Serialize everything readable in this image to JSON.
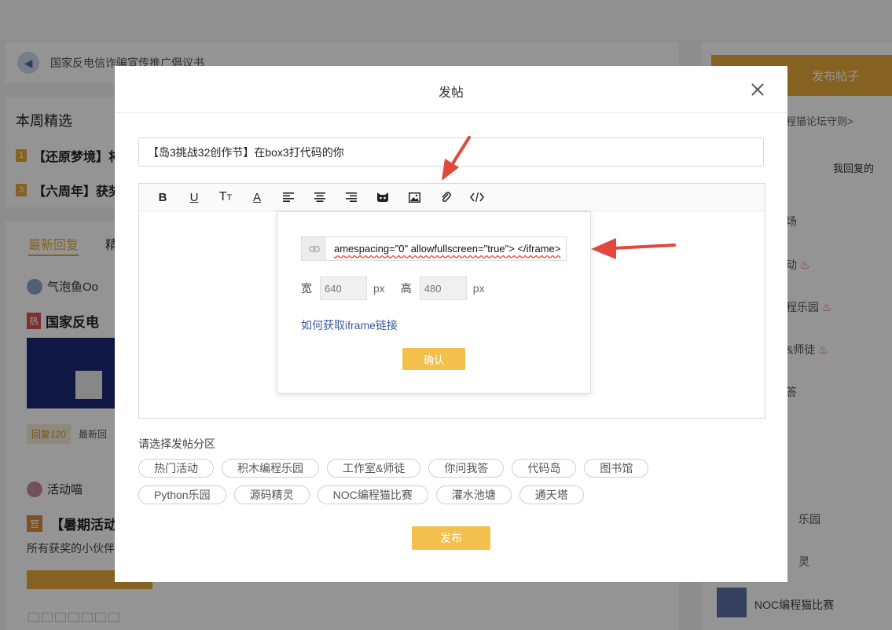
{
  "background": {
    "notice_text": "国家反电信诈骗宣传推广倡议书",
    "weekly_title": "本周精选",
    "weekly_items": [
      {
        "rank": "1",
        "text": "【还原梦境】将"
      },
      {
        "rank": "3",
        "text": "【六周年】获奖"
      }
    ],
    "tabs": [
      "最新回复",
      "精"
    ],
    "post1_user": "气泡鱼Oo",
    "post1_hot_tag": "热",
    "post1_title": "国家反电",
    "post1_reply_tag": "回复120",
    "post1_reply_text": "最新回",
    "post2_user": "活动喵",
    "post2_tag": "官",
    "post2_title": "【暑期活动",
    "post2_desc": "所有获奖的小伙伴",
    "right_post_button": "发布帖子",
    "right_rules": "程猫论坛守则>",
    "right_my_replies": "我回复的",
    "right_sections": [
      "场",
      "动",
      "程乐园",
      "&师徒",
      "答",
      "乐园",
      "灵"
    ],
    "right_noc": "NOC编程猫比赛"
  },
  "modal": {
    "title": "发帖",
    "post_title_value": "【岛3挑战32创作节】在box3打代码的你",
    "toolbar_icons": [
      "bold-icon",
      "underline-icon",
      "text-size-icon",
      "font-color-icon",
      "align-left-icon",
      "align-center-icon",
      "align-right-icon",
      "codemao-cat-icon",
      "image-icon",
      "attachment-icon",
      "code-icon"
    ],
    "iframe_popup": {
      "link_value": "amespacing=\"0\" allowfullscreen=\"true\"> </iframe>",
      "width_label": "宽",
      "width_value": "640",
      "height_label": "高",
      "height_value": "480",
      "unit": "px",
      "help_link": "如何获取iframe链接",
      "confirm": "确认"
    },
    "section_label": "请选择发帖分区",
    "sections": [
      "热门活动",
      "积木编程乐园",
      "工作室&师徒",
      "你问我答",
      "代码岛",
      "图书馆",
      "Python乐园",
      "源码精灵",
      "NOC编程猫比赛",
      "灌水池塘",
      "通天塔"
    ],
    "publish": "发布"
  },
  "colors": {
    "accent": "#f3c14b",
    "annotation_arrow": "#e0493b",
    "link": "#3a5a9f"
  }
}
